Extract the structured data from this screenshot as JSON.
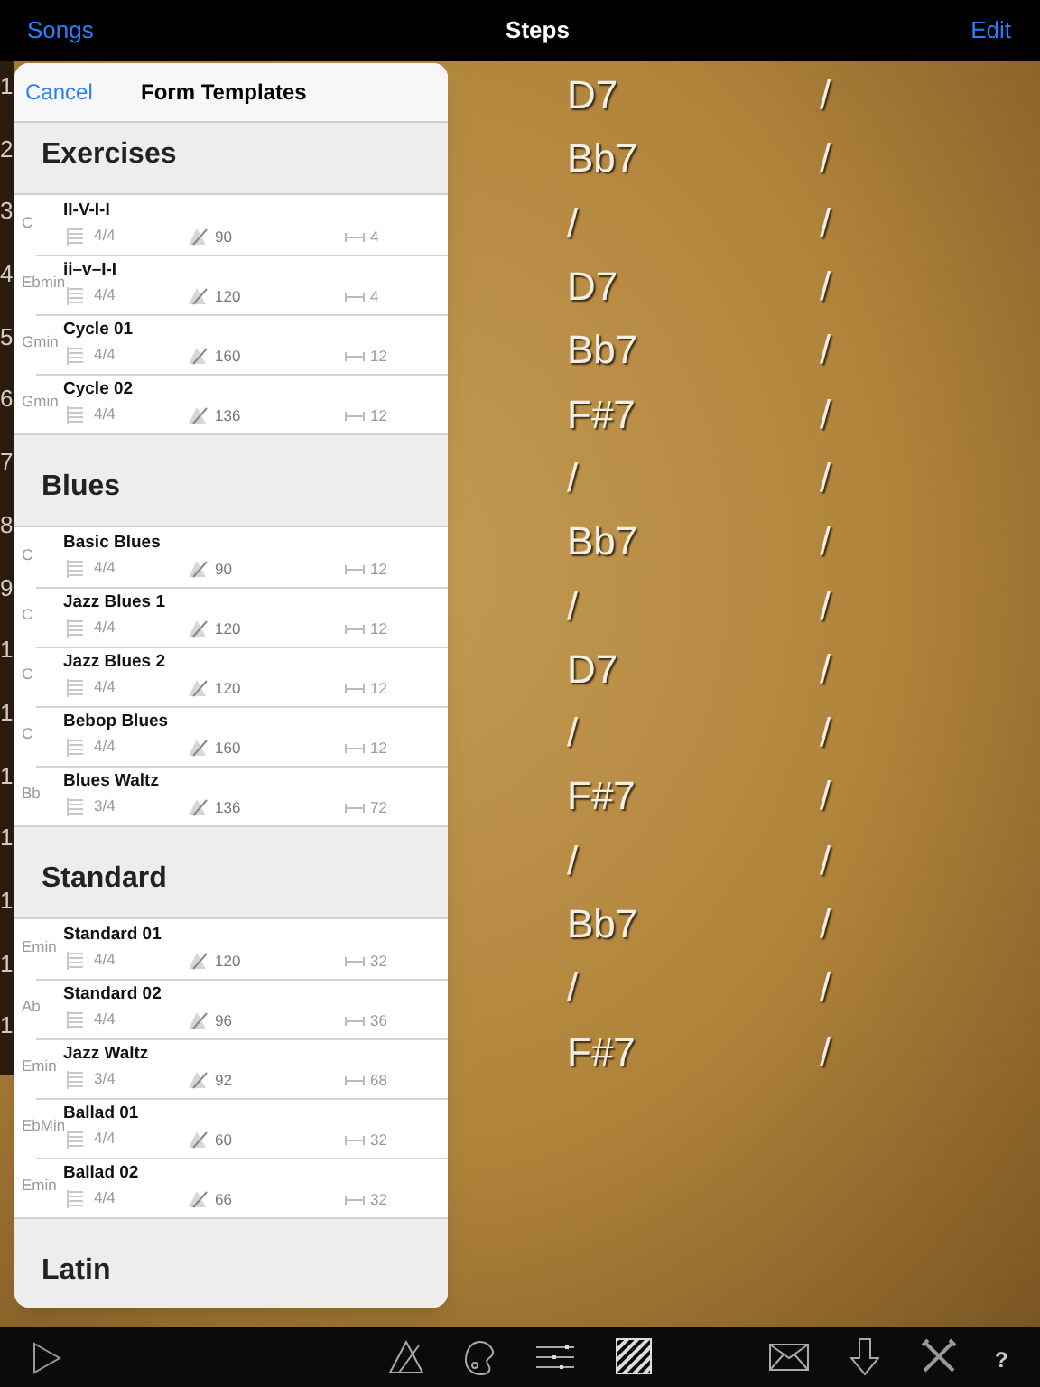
{
  "nav": {
    "left_button": "Songs",
    "title": "Steps",
    "right_button": "Edit"
  },
  "line_numbers": [
    "1",
    "2",
    "3",
    "4",
    "5",
    "6",
    "7",
    "8",
    "9",
    "1",
    "1",
    "1",
    "1",
    "1",
    "1",
    "1"
  ],
  "chords": [
    {
      "chord": "D7",
      "beat": "/"
    },
    {
      "chord": "Bb7",
      "beat": "/"
    },
    {
      "chord": "/",
      "beat": "/"
    },
    {
      "chord": "D7",
      "beat": "/"
    },
    {
      "chord": "Bb7",
      "beat": "/"
    },
    {
      "chord": "F#7",
      "beat": "/"
    },
    {
      "chord": "/",
      "beat": "/"
    },
    {
      "chord": "Bb7",
      "beat": "/"
    },
    {
      "chord": "/",
      "beat": "/"
    },
    {
      "chord": "D7",
      "beat": "/"
    },
    {
      "chord": "/",
      "beat": "/"
    },
    {
      "chord": "F#7",
      "beat": "/"
    },
    {
      "chord": "/",
      "beat": "/"
    },
    {
      "chord": "Bb7",
      "beat": "/"
    },
    {
      "chord": "/",
      "beat": "/"
    },
    {
      "chord": "F#7",
      "beat": "/"
    }
  ],
  "popover": {
    "cancel": "Cancel",
    "title": "Form Templates",
    "sections": [
      {
        "title": "Exercises",
        "templates": [
          {
            "key": "C",
            "name": "II-V-I-I",
            "meter": "4/4",
            "tempo": "90",
            "bars": "4"
          },
          {
            "key": "Ebmin",
            "name": "ii–v–I-I",
            "meter": "4/4",
            "tempo": "120",
            "bars": "4"
          },
          {
            "key": "Gmin",
            "name": "Cycle 01",
            "meter": "4/4",
            "tempo": "160",
            "bars": "12"
          },
          {
            "key": "Gmin",
            "name": "Cycle 02",
            "meter": "4/4",
            "tempo": "136",
            "bars": "12"
          }
        ]
      },
      {
        "title": "Blues",
        "templates": [
          {
            "key": "C",
            "name": "Basic Blues",
            "meter": "4/4",
            "tempo": "90",
            "bars": "12"
          },
          {
            "key": "C",
            "name": "Jazz Blues 1",
            "meter": "4/4",
            "tempo": "120",
            "bars": "12"
          },
          {
            "key": "C",
            "name": "Jazz Blues 2",
            "meter": "4/4",
            "tempo": "120",
            "bars": "12"
          },
          {
            "key": "C",
            "name": "Bebop Blues",
            "meter": "4/4",
            "tempo": "160",
            "bars": "12"
          },
          {
            "key": "Bb",
            "name": "Blues Waltz",
            "meter": "3/4",
            "tempo": "136",
            "bars": "72"
          }
        ]
      },
      {
        "title": "Standard",
        "templates": [
          {
            "key": "Emin",
            "name": "Standard 01",
            "meter": "4/4",
            "tempo": "120",
            "bars": "32"
          },
          {
            "key": "Ab",
            "name": "Standard 02",
            "meter": "4/4",
            "tempo": "96",
            "bars": "36"
          },
          {
            "key": "Emin",
            "name": "Jazz Waltz",
            "meter": "3/4",
            "tempo": "92",
            "bars": "68"
          },
          {
            "key": "EbMin",
            "name": "Ballad 01",
            "meter": "4/4",
            "tempo": "60",
            "bars": "32"
          },
          {
            "key": "Emin",
            "name": "Ballad 02",
            "meter": "4/4",
            "tempo": "66",
            "bars": "32"
          }
        ]
      },
      {
        "title": "Latin"
      }
    ]
  },
  "toolbar": {
    "help": "?"
  }
}
